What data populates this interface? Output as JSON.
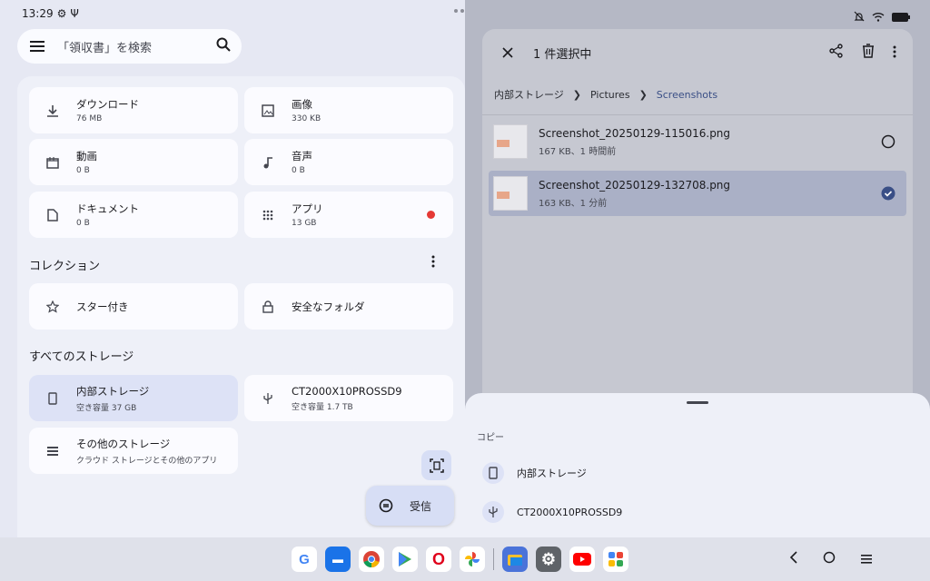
{
  "status": {
    "time": "13:29"
  },
  "search": {
    "placeholder": "「領収書」を検索"
  },
  "categories": [
    {
      "label": "ダウンロード",
      "size": "76 MB",
      "icon": "download-icon"
    },
    {
      "label": "画像",
      "size": "330 KB",
      "icon": "image-icon"
    },
    {
      "label": "動画",
      "size": "0 B",
      "icon": "video-icon"
    },
    {
      "label": "音声",
      "size": "0 B",
      "icon": "music-icon"
    },
    {
      "label": "ドキュメント",
      "size": "0 B",
      "icon": "document-icon"
    },
    {
      "label": "アプリ",
      "size": "13 GB",
      "icon": "apps-grid-icon"
    }
  ],
  "collection": {
    "title": "コレクション",
    "items": [
      {
        "label": "スター付き",
        "icon": "star-icon"
      },
      {
        "label": "安全なフォルダ",
        "icon": "lock-icon"
      }
    ]
  },
  "storage": {
    "title": "すべてのストレージ",
    "items": [
      {
        "label": "内部ストレージ",
        "detail": "空き容量 37 GB",
        "icon": "phone-icon"
      },
      {
        "label": "CT2000X10PROSSD9",
        "detail": "空き容量 1.7 TB",
        "icon": "usb-icon"
      },
      {
        "label": "その他のストレージ",
        "detail": "クラウド ストレージとその他のアプリ",
        "icon": "storage-list-icon"
      }
    ]
  },
  "fab": {
    "label": "受信"
  },
  "file_manager": {
    "title": "1 件選択中",
    "breadcrumbs": [
      "内部ストレージ",
      "Pictures",
      "Screenshots"
    ],
    "files": [
      {
        "name": "Screenshot_20250129-115016.png",
        "meta": "167 KB、1 時間前",
        "selected": false
      },
      {
        "name": "Screenshot_20250129-132708.png",
        "meta": "163 KB、1 分前",
        "selected": true
      }
    ]
  },
  "sheet": {
    "label": "コピー",
    "options": [
      {
        "label": "内部ストレージ",
        "icon": "phone-icon"
      },
      {
        "label": "CT2000X10PROSSD9",
        "icon": "usb-icon"
      }
    ]
  },
  "taskbar": {
    "apps": [
      "google",
      "messages",
      "chrome",
      "play-store",
      "opera",
      "photos",
      "files",
      "settings",
      "youtube",
      "app-drawer"
    ]
  },
  "colors": {
    "accent": "#3a4f86",
    "selected_card": "#dde2f6",
    "red_dot": "#e53935"
  }
}
